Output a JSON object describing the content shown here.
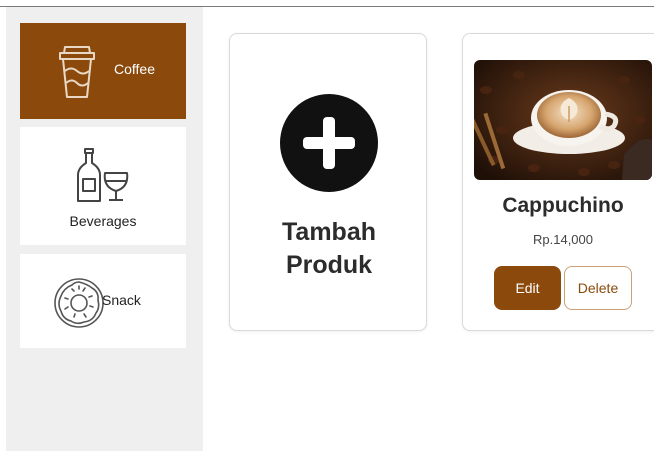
{
  "theme": {
    "accent": "#8b4a0c",
    "sidebar_bg": "#efefef"
  },
  "sidebar": {
    "categories": [
      {
        "label": "Coffee",
        "icon": "coffee-cup-icon",
        "active": true
      },
      {
        "label": "Beverages",
        "icon": "bottle-glass-icon",
        "active": false
      },
      {
        "label": "Snack",
        "icon": "donut-icon",
        "active": false
      }
    ]
  },
  "main": {
    "add_product": {
      "line1": "Tambah",
      "line2": "Produk",
      "icon": "plus-circle-icon"
    },
    "products": [
      {
        "name": "Cappuchino",
        "price": "Rp.14,000",
        "edit_label": "Edit",
        "delete_label": "Delete"
      }
    ]
  }
}
